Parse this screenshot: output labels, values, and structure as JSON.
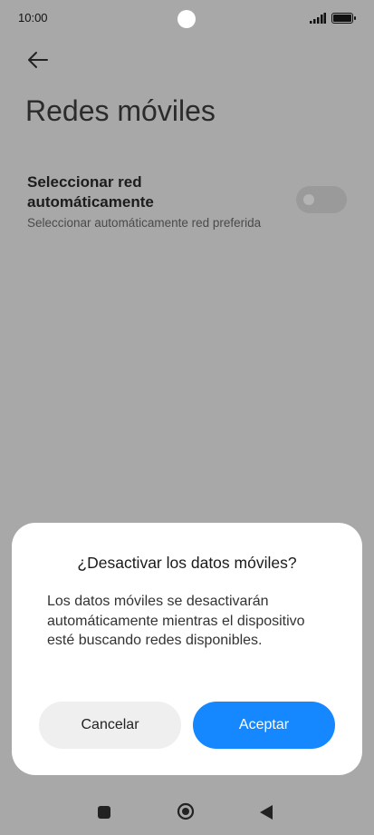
{
  "status_bar": {
    "time": "10:00"
  },
  "header": {
    "title": "Redes móviles"
  },
  "setting": {
    "title": "Seleccionar red automáticamente",
    "subtitle": "Seleccionar automáticamente red preferida",
    "toggle_on": false
  },
  "dialog": {
    "title": "¿Desactivar los datos móviles?",
    "message": "Los datos móviles se desactivarán automáticamente mientras el dispositivo esté buscando redes disponibles.",
    "cancel_label": "Cancelar",
    "accept_label": "Aceptar"
  },
  "colors": {
    "accent": "#1588ff",
    "scrim": "#a8a8a8"
  },
  "icons": [
    "camera-icon",
    "signal-icon",
    "battery-icon",
    "back-arrow-icon",
    "nav-recents-icon",
    "nav-home-icon",
    "nav-back-icon"
  ]
}
